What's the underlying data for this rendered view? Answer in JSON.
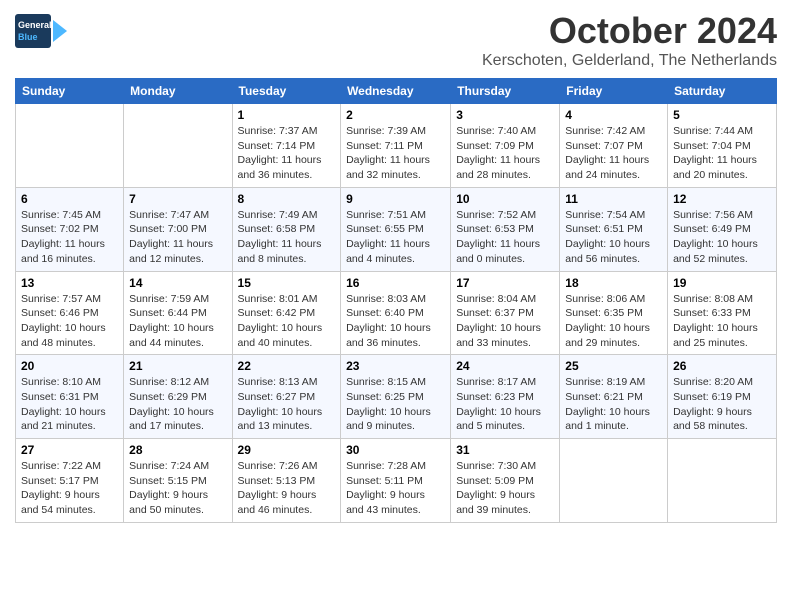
{
  "header": {
    "logo_line1": "General",
    "logo_line2": "Blue",
    "month": "October 2024",
    "location": "Kerschoten, Gelderland, The Netherlands"
  },
  "days_of_week": [
    "Sunday",
    "Monday",
    "Tuesday",
    "Wednesday",
    "Thursday",
    "Friday",
    "Saturday"
  ],
  "weeks": [
    [
      {
        "day": "",
        "info": ""
      },
      {
        "day": "",
        "info": ""
      },
      {
        "day": "1",
        "info": "Sunrise: 7:37 AM\nSunset: 7:14 PM\nDaylight: 11 hours\nand 36 minutes."
      },
      {
        "day": "2",
        "info": "Sunrise: 7:39 AM\nSunset: 7:11 PM\nDaylight: 11 hours\nand 32 minutes."
      },
      {
        "day": "3",
        "info": "Sunrise: 7:40 AM\nSunset: 7:09 PM\nDaylight: 11 hours\nand 28 minutes."
      },
      {
        "day": "4",
        "info": "Sunrise: 7:42 AM\nSunset: 7:07 PM\nDaylight: 11 hours\nand 24 minutes."
      },
      {
        "day": "5",
        "info": "Sunrise: 7:44 AM\nSunset: 7:04 PM\nDaylight: 11 hours\nand 20 minutes."
      }
    ],
    [
      {
        "day": "6",
        "info": "Sunrise: 7:45 AM\nSunset: 7:02 PM\nDaylight: 11 hours\nand 16 minutes."
      },
      {
        "day": "7",
        "info": "Sunrise: 7:47 AM\nSunset: 7:00 PM\nDaylight: 11 hours\nand 12 minutes."
      },
      {
        "day": "8",
        "info": "Sunrise: 7:49 AM\nSunset: 6:58 PM\nDaylight: 11 hours\nand 8 minutes."
      },
      {
        "day": "9",
        "info": "Sunrise: 7:51 AM\nSunset: 6:55 PM\nDaylight: 11 hours\nand 4 minutes."
      },
      {
        "day": "10",
        "info": "Sunrise: 7:52 AM\nSunset: 6:53 PM\nDaylight: 11 hours\nand 0 minutes."
      },
      {
        "day": "11",
        "info": "Sunrise: 7:54 AM\nSunset: 6:51 PM\nDaylight: 10 hours\nand 56 minutes."
      },
      {
        "day": "12",
        "info": "Sunrise: 7:56 AM\nSunset: 6:49 PM\nDaylight: 10 hours\nand 52 minutes."
      }
    ],
    [
      {
        "day": "13",
        "info": "Sunrise: 7:57 AM\nSunset: 6:46 PM\nDaylight: 10 hours\nand 48 minutes."
      },
      {
        "day": "14",
        "info": "Sunrise: 7:59 AM\nSunset: 6:44 PM\nDaylight: 10 hours\nand 44 minutes."
      },
      {
        "day": "15",
        "info": "Sunrise: 8:01 AM\nSunset: 6:42 PM\nDaylight: 10 hours\nand 40 minutes."
      },
      {
        "day": "16",
        "info": "Sunrise: 8:03 AM\nSunset: 6:40 PM\nDaylight: 10 hours\nand 36 minutes."
      },
      {
        "day": "17",
        "info": "Sunrise: 8:04 AM\nSunset: 6:37 PM\nDaylight: 10 hours\nand 33 minutes."
      },
      {
        "day": "18",
        "info": "Sunrise: 8:06 AM\nSunset: 6:35 PM\nDaylight: 10 hours\nand 29 minutes."
      },
      {
        "day": "19",
        "info": "Sunrise: 8:08 AM\nSunset: 6:33 PM\nDaylight: 10 hours\nand 25 minutes."
      }
    ],
    [
      {
        "day": "20",
        "info": "Sunrise: 8:10 AM\nSunset: 6:31 PM\nDaylight: 10 hours\nand 21 minutes."
      },
      {
        "day": "21",
        "info": "Sunrise: 8:12 AM\nSunset: 6:29 PM\nDaylight: 10 hours\nand 17 minutes."
      },
      {
        "day": "22",
        "info": "Sunrise: 8:13 AM\nSunset: 6:27 PM\nDaylight: 10 hours\nand 13 minutes."
      },
      {
        "day": "23",
        "info": "Sunrise: 8:15 AM\nSunset: 6:25 PM\nDaylight: 10 hours\nand 9 minutes."
      },
      {
        "day": "24",
        "info": "Sunrise: 8:17 AM\nSunset: 6:23 PM\nDaylight: 10 hours\nand 5 minutes."
      },
      {
        "day": "25",
        "info": "Sunrise: 8:19 AM\nSunset: 6:21 PM\nDaylight: 10 hours\nand 1 minute."
      },
      {
        "day": "26",
        "info": "Sunrise: 8:20 AM\nSunset: 6:19 PM\nDaylight: 9 hours\nand 58 minutes."
      }
    ],
    [
      {
        "day": "27",
        "info": "Sunrise: 7:22 AM\nSunset: 5:17 PM\nDaylight: 9 hours\nand 54 minutes."
      },
      {
        "day": "28",
        "info": "Sunrise: 7:24 AM\nSunset: 5:15 PM\nDaylight: 9 hours\nand 50 minutes."
      },
      {
        "day": "29",
        "info": "Sunrise: 7:26 AM\nSunset: 5:13 PM\nDaylight: 9 hours\nand 46 minutes."
      },
      {
        "day": "30",
        "info": "Sunrise: 7:28 AM\nSunset: 5:11 PM\nDaylight: 9 hours\nand 43 minutes."
      },
      {
        "day": "31",
        "info": "Sunrise: 7:30 AM\nSunset: 5:09 PM\nDaylight: 9 hours\nand 39 minutes."
      },
      {
        "day": "",
        "info": ""
      },
      {
        "day": "",
        "info": ""
      }
    ]
  ]
}
